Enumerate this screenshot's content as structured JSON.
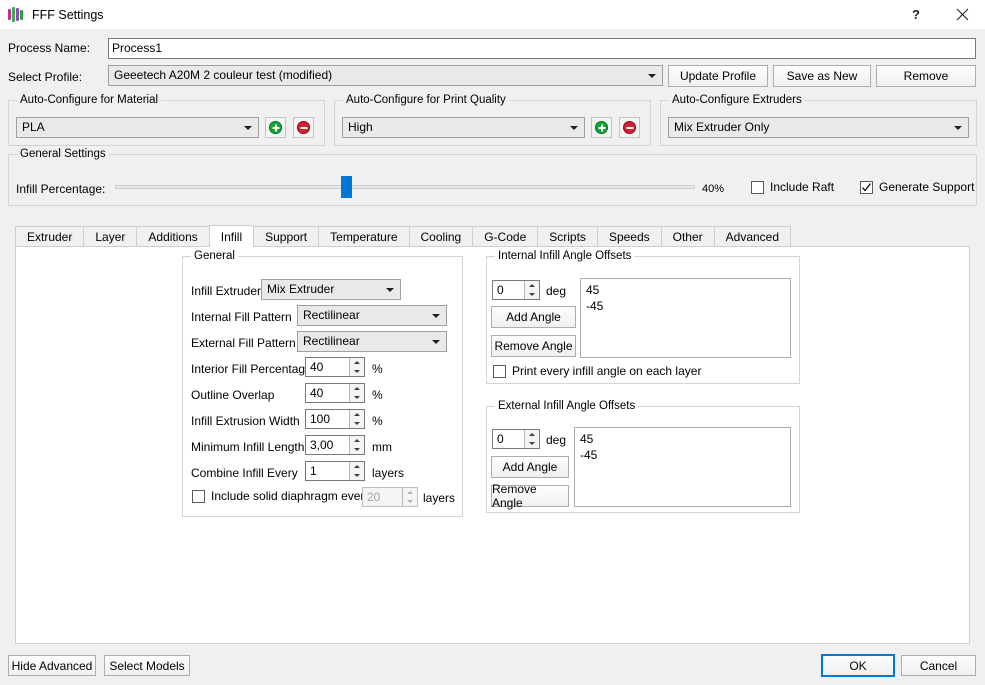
{
  "window": {
    "title": "FFF Settings",
    "icon": "fff-logo-icon",
    "help_label": "?",
    "close_label": "✕"
  },
  "form": {
    "process_name_label": "Process Name:",
    "process_name_value": "Process1",
    "select_profile_label": "Select Profile:",
    "select_profile_value": "Geeetech A20M 2 couleur test (modified)",
    "update_profile_label": "Update Profile",
    "save_as_new_label": "Save as New",
    "remove_label": "Remove"
  },
  "auto_material": {
    "title": "Auto-Configure for Material",
    "value": "PLA",
    "add_label": "+",
    "remove_label": "−"
  },
  "auto_quality": {
    "title": "Auto-Configure for Print Quality",
    "value": "High",
    "add_label": "+",
    "remove_label": "−"
  },
  "auto_extruders": {
    "title": "Auto-Configure Extruders",
    "value": "Mix Extruder Only"
  },
  "general_settings": {
    "title": "General Settings",
    "infill_label": "Infill Percentage:",
    "infill_value": "40%",
    "infill_percent": 40,
    "include_raft_label": "Include Raft",
    "include_raft_checked": false,
    "generate_support_label": "Generate Support",
    "generate_support_checked": true
  },
  "tabs": [
    {
      "label": "Extruder",
      "active": false
    },
    {
      "label": "Layer",
      "active": false
    },
    {
      "label": "Additions",
      "active": false
    },
    {
      "label": "Infill",
      "active": true
    },
    {
      "label": "Support",
      "active": false
    },
    {
      "label": "Temperature",
      "active": false
    },
    {
      "label": "Cooling",
      "active": false
    },
    {
      "label": "G-Code",
      "active": false
    },
    {
      "label": "Scripts",
      "active": false
    },
    {
      "label": "Speeds",
      "active": false
    },
    {
      "label": "Other",
      "active": false
    },
    {
      "label": "Advanced",
      "active": false
    }
  ],
  "infill_general": {
    "title": "General",
    "infill_extruder_label": "Infill Extruder",
    "infill_extruder_value": "Mix Extruder",
    "internal_fill_label": "Internal Fill Pattern",
    "internal_fill_value": "Rectilinear",
    "external_fill_label": "External Fill Pattern",
    "external_fill_value": "Rectilinear",
    "interior_fill_label": "Interior Fill Percentage",
    "interior_fill_value": "40",
    "interior_fill_unit": "%",
    "outline_overlap_label": "Outline Overlap",
    "outline_overlap_value": "40",
    "outline_overlap_unit": "%",
    "infill_width_label": "Infill Extrusion Width",
    "infill_width_value": "100",
    "infill_width_unit": "%",
    "min_infill_label": "Minimum Infill Length",
    "min_infill_value": "3,00",
    "min_infill_unit": "mm",
    "combine_infill_label": "Combine Infill Every",
    "combine_infill_value": "1",
    "combine_infill_unit": "layers",
    "diaphragm_label": "Include solid diaphragm every",
    "diaphragm_checked": false,
    "diaphragm_value": "20",
    "diaphragm_unit": "layers"
  },
  "internal_offsets": {
    "title": "Internal Infill Angle Offsets",
    "deg_value": "0",
    "deg_unit": "deg",
    "add_angle_label": "Add Angle",
    "remove_angle_label": "Remove Angle",
    "angles": "45\n-45",
    "print_every_label": "Print every infill angle on each layer",
    "print_every_checked": false
  },
  "external_offsets": {
    "title": "External Infill Angle Offsets",
    "deg_value": "0",
    "deg_unit": "deg",
    "add_angle_label": "Add Angle",
    "remove_angle_label": "Remove Angle",
    "angles": "45\n-45"
  },
  "footer": {
    "hide_advanced_label": "Hide Advanced",
    "select_models_label": "Select Models",
    "ok_label": "OK",
    "cancel_label": "Cancel"
  },
  "colors": {
    "accent": "#0078d7",
    "window_bg": "#f0f0f0",
    "panel_bg": "#ffffff",
    "add_green": "#13a538",
    "remove_red": "#cf2034"
  }
}
